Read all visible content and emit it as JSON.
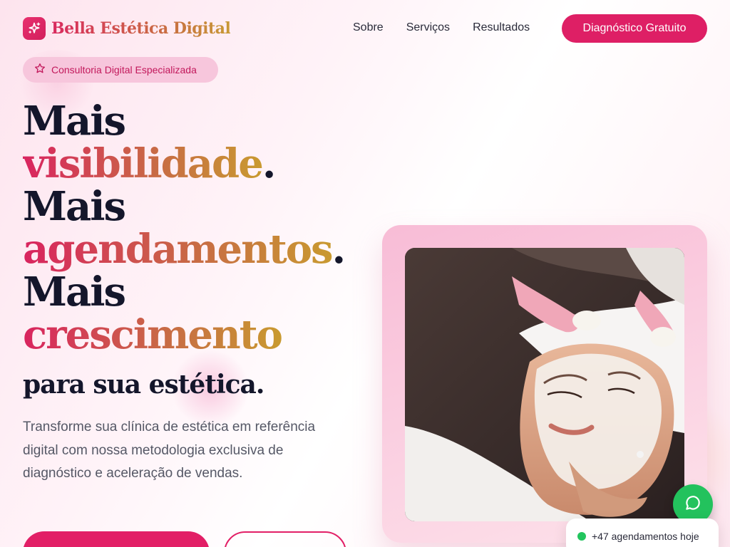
{
  "brand": {
    "name": "Bella Estética Digital",
    "icon": "sparkles-icon",
    "accent_color": "#de1f65"
  },
  "nav": {
    "items": [
      "Sobre",
      "Serviços",
      "Resultados"
    ],
    "cta_label": "Diagnóstico Gratuito"
  },
  "hero": {
    "badge": {
      "icon": "star-icon",
      "label": "Consultoria Digital Especializada"
    },
    "headline": {
      "line1": "Mais",
      "line2_word": "visibilidade",
      "line3": "Mais",
      "line4_word": "agendamentos",
      "line5": "Mais",
      "line6_word": "crescimento",
      "tagline": "para sua estética",
      "period": "."
    },
    "lead": "Transforme sua clínica de estética em referência digital com nossa metodologia exclusiva de diagnóstico e aceleração de vendas.",
    "image": "facial-treatment-photo"
  },
  "widgets": {
    "whatsapp_icon": "whatsapp-icon",
    "status_text": "+47 agendamentos hoje",
    "status_color": "#22c55e"
  }
}
